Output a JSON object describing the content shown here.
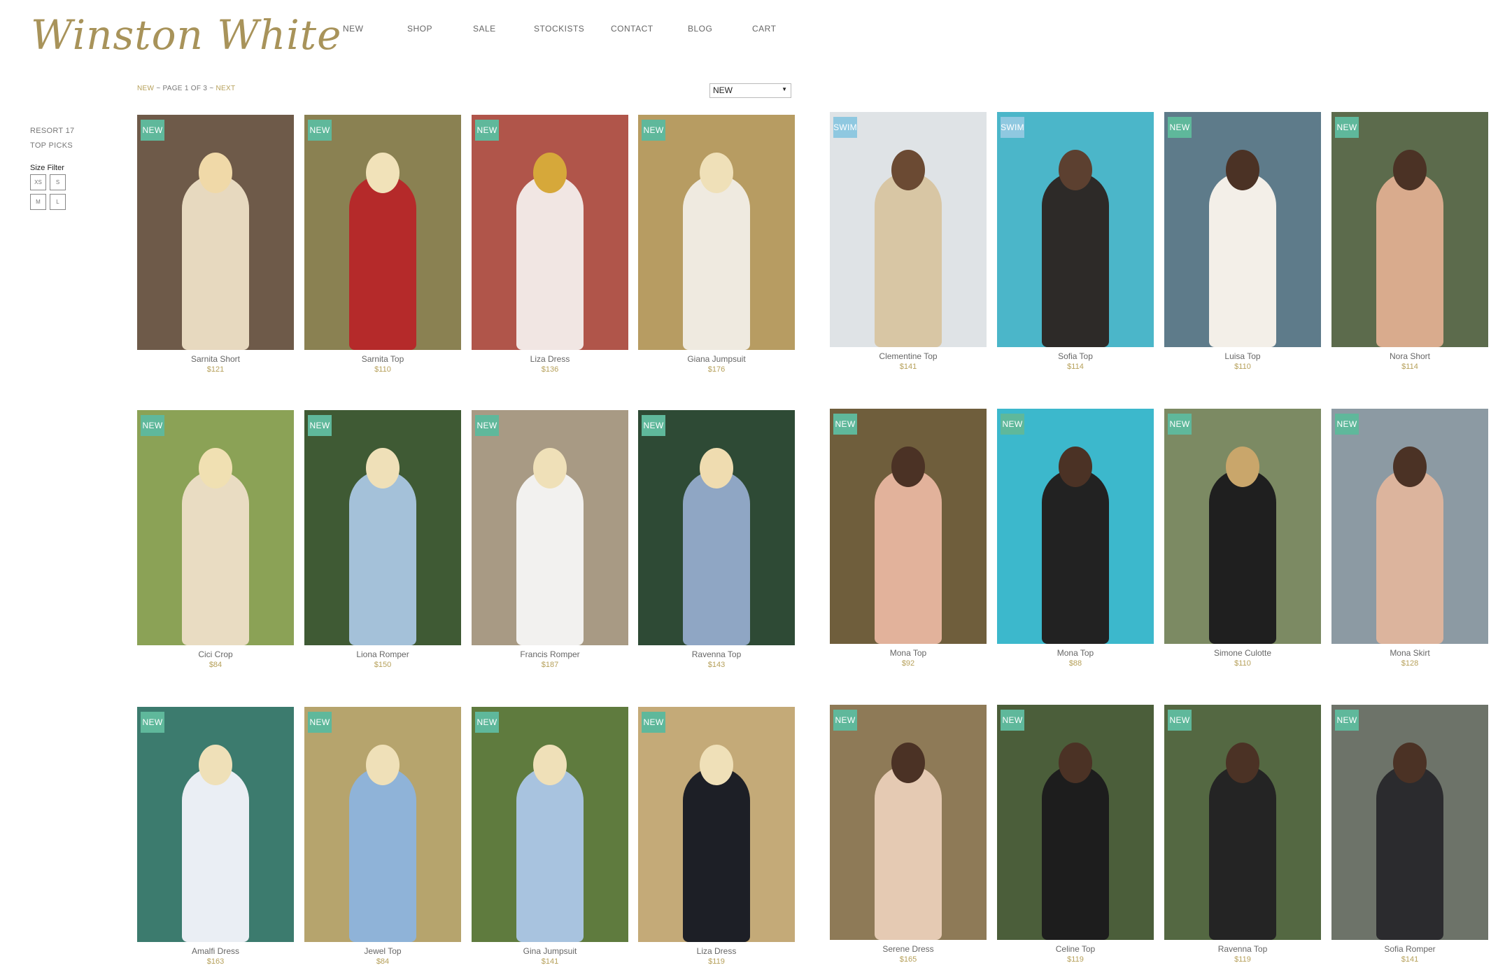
{
  "logo": "Winston White",
  "nav": [
    "NEW",
    "SHOP",
    "SALE",
    "STOCKISTS",
    "CONTACT",
    "BLOG",
    "CART"
  ],
  "pager": {
    "new": "NEW",
    "sep1": " ~ ",
    "page": "PAGE 1 OF 3",
    "sep2": " ~ ",
    "next": "NEXT"
  },
  "sort": {
    "selected": "NEW"
  },
  "sidebar": {
    "links": [
      "RESORT 17",
      "TOP PICKS"
    ],
    "size_title": "Size Filter",
    "sizes": [
      "XS",
      "S",
      "M",
      "L"
    ]
  },
  "colors": {
    "gold": "#b6a05a",
    "badge_new": "#5fb89b",
    "badge_swim": "#8fc8e0"
  },
  "products": [
    {
      "name": "Sarnita Short",
      "price": "$121",
      "badge": "NEW",
      "bg": "#6e5a49",
      "body": "#e7d9bf",
      "head": "#f0d9a8"
    },
    {
      "name": "Sarnita Top",
      "price": "$110",
      "badge": "NEW",
      "bg": "#8a8152",
      "body": "#b52a2a",
      "head": "#f1e2b9"
    },
    {
      "name": "Liza Dress",
      "price": "$136",
      "badge": "NEW",
      "bg": "#b0554a",
      "body": "#f1e6e3",
      "head": "#d6a83a"
    },
    {
      "name": "Giana Jumpsuit",
      "price": "$176",
      "badge": "NEW",
      "bg": "#b79c62",
      "body": "#efeae0",
      "head": "#efe0b8"
    },
    {
      "name": "Clementine Top",
      "price": "$141",
      "badge": "SWIM",
      "bg": "#dfe3e6",
      "body": "#d8c6a4",
      "head": "#6b4a33"
    },
    {
      "name": "Sofia Top",
      "price": "$114",
      "badge": "SWIM",
      "bg": "#4bb6c9",
      "body": "#2d2a28",
      "head": "#5c4030"
    },
    {
      "name": "Luisa Top",
      "price": "$110",
      "badge": "NEW",
      "bg": "#5e7b8a",
      "body": "#f3efe8",
      "head": "#4b3225"
    },
    {
      "name": "Nora Short",
      "price": "$114",
      "badge": "NEW",
      "bg": "#5c6b4c",
      "body": "#d9ab8d",
      "head": "#4b3225"
    },
    {
      "name": "Cici Crop",
      "price": "$84",
      "badge": "NEW",
      "bg": "#8ba256",
      "body": "#e9dcc2",
      "head": "#f0e0b2"
    },
    {
      "name": "Liona Romper",
      "price": "$150",
      "badge": "NEW",
      "bg": "#3f5a34",
      "body": "#a4c1d9",
      "head": "#efe0b8"
    },
    {
      "name": "Francis Romper",
      "price": "$187",
      "badge": "NEW",
      "bg": "#a89a84",
      "body": "#f2f1ef",
      "head": "#efe0b8"
    },
    {
      "name": "Ravenna Top",
      "price": "$143",
      "badge": "NEW",
      "bg": "#2e4a35",
      "body": "#8fa6c4",
      "head": "#efdcb0"
    },
    {
      "name": "Mona Top",
      "price": "$92",
      "badge": "NEW",
      "bg": "#6f5e3c",
      "body": "#e2b29b",
      "head": "#4b3225"
    },
    {
      "name": "Mona Top",
      "price": "$88",
      "badge": "NEW",
      "bg": "#3cb8cc",
      "body": "#222222",
      "head": "#4b3225"
    },
    {
      "name": "Simone Culotte",
      "price": "$110",
      "badge": "NEW",
      "bg": "#7c8a63",
      "body": "#1f1f1f",
      "head": "#c9a66b"
    },
    {
      "name": "Mona Skirt",
      "price": "$128",
      "badge": "NEW",
      "bg": "#8c9aa3",
      "body": "#dcb49d",
      "head": "#4b3225"
    },
    {
      "name": "Amalfi Dress",
      "price": "$163",
      "badge": "NEW",
      "bg": "#3c7b6e",
      "body": "#eaeef4",
      "head": "#efe0b8"
    },
    {
      "name": "Jewel Top",
      "price": "$84",
      "badge": "NEW",
      "bg": "#b6a46d",
      "body": "#8fb3d8",
      "head": "#efe0b8"
    },
    {
      "name": "Gina Jumpsuit",
      "price": "$141",
      "badge": "NEW",
      "bg": "#5f7b3e",
      "body": "#a8c3df",
      "head": "#efe0b8"
    },
    {
      "name": "Liza Dress",
      "price": "$119",
      "badge": "NEW",
      "bg": "#c4aa78",
      "body": "#1d1f26",
      "head": "#efe0b8"
    },
    {
      "name": "Serene Dress",
      "price": "$165",
      "badge": "NEW",
      "bg": "#8e7a57",
      "body": "#e5cab3",
      "head": "#4b3225"
    },
    {
      "name": "Celine Top",
      "price": "$119",
      "badge": "NEW",
      "bg": "#4b5e3a",
      "body": "#1d1d1d",
      "head": "#4b3225"
    },
    {
      "name": "Ravenna Top",
      "price": "$119",
      "badge": "NEW",
      "bg": "#546842",
      "body": "#242424",
      "head": "#4b3225"
    },
    {
      "name": "Sofia Romper",
      "price": "$141",
      "badge": "NEW",
      "bg": "#6d7369",
      "body": "#2b2b2e",
      "head": "#4b3225"
    }
  ]
}
